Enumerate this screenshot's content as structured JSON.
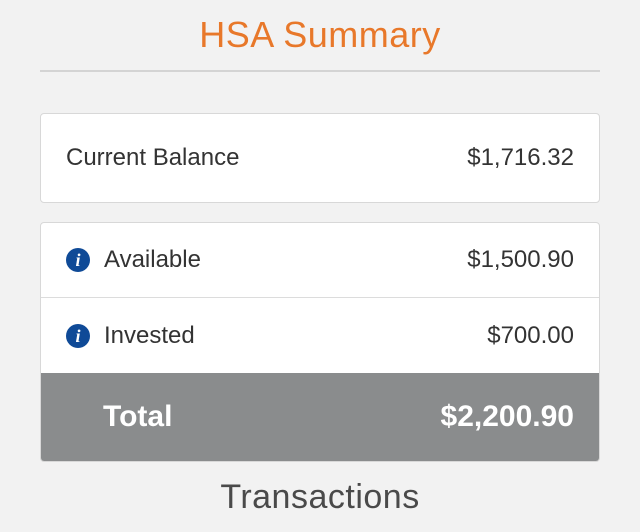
{
  "header": {
    "title": "HSA Summary"
  },
  "balance": {
    "label": "Current Balance",
    "value": "$1,716.32"
  },
  "breakdown": {
    "available": {
      "label": "Available",
      "value": "$1,500.90",
      "icon": "info-icon"
    },
    "invested": {
      "label": "Invested",
      "value": "$700.00",
      "icon": "info-icon"
    },
    "total": {
      "label": "Total",
      "value": "$2,200.90"
    }
  },
  "footer": {
    "transactions_label": "Transactions"
  },
  "colors": {
    "title": "#e8782a",
    "info_icon": "#0f4a97",
    "total_bg": "#8a8c8d",
    "background": "#f2f2f2"
  }
}
